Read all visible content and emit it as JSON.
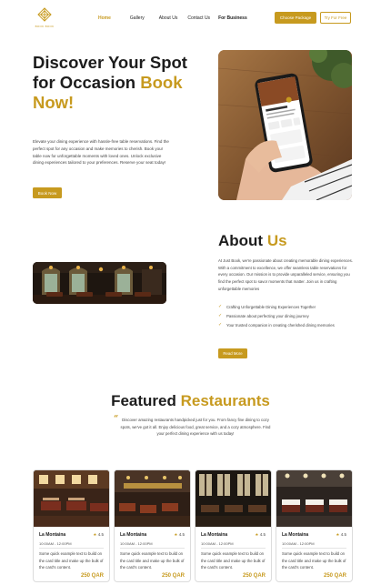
{
  "brand": {
    "logo_text": "BOOK BOOK",
    "accent": "#c79a1f"
  },
  "nav": {
    "items": [
      {
        "label": "Home"
      },
      {
        "label": "Gallery"
      },
      {
        "label": "About Us"
      },
      {
        "label": "Contact Us"
      },
      {
        "label": "For Business"
      }
    ],
    "choose_package": "Choose Package",
    "try_free": "Try For Free"
  },
  "hero": {
    "title_part1": "Discover Your Spot for Occasion ",
    "title_accent": "Book Now!",
    "description": "Elevate your dining experience with hassle-free table reservations. Find the perfect spot for any occasion and make memories to cherish. Book your table now for unforgettable moments with loved ones. Unlock exclusive dining experiences tailored to your preferences. Reserve your seat today!",
    "button": "Book Now",
    "image_icon": "phone-in-hand-image"
  },
  "about": {
    "title_part1": "About ",
    "title_accent": "Us",
    "description": "At Just Book, we're passionate about creating memorable dining experiences. With a commitment to excellence, we offer seamless table reservations for every occasion. Our mission is to provide unparalleled service, ensuring you find the perfect spot to savor moments that matter. Join us in crafting unforgettable memories",
    "list": [
      "Crafting Unforgettable Dining Experiences Together",
      "Passionate about perfecting your dining journey",
      "Your trusted companion in creating cherished dining memories"
    ],
    "button": "Read More",
    "image_icon": "restaurant-interior-image"
  },
  "featured": {
    "title_part1": "Featured ",
    "title_accent": "Restaurants",
    "description": "Discover amazing restaurants handpicked just for you. From fancy fine dining to cozy spots, we've got it all. Enjoy delicious food, great service, and a cozy atmosphere. Find your perfect dining experience with us today!"
  },
  "cards": [
    {
      "name": "La Montaina",
      "rating": "4.5",
      "time": "10:00AM - 12:00PM",
      "text": "Some quick example text to build on the card title and make up the bulk of the card's content.",
      "price": "250 QAR"
    },
    {
      "name": "La Montaina",
      "rating": "4.5",
      "time": "10:00AM - 12:00PM",
      "text": "Some quick example text to build on the card title and make up the bulk of the card's content.",
      "price": "250 QAR"
    },
    {
      "name": "La Montaina",
      "rating": "4.5",
      "time": "10:00AM - 12:00PM",
      "text": "Some quick example text to build on the card title and make up the bulk of the card's content.",
      "price": "250 QAR"
    },
    {
      "name": "La Montaina",
      "rating": "4.5",
      "time": "10:00AM - 12:00PM",
      "text": "Some quick example text to build on the card title and make up the bulk of the card's content.",
      "price": "250 QAR"
    }
  ]
}
